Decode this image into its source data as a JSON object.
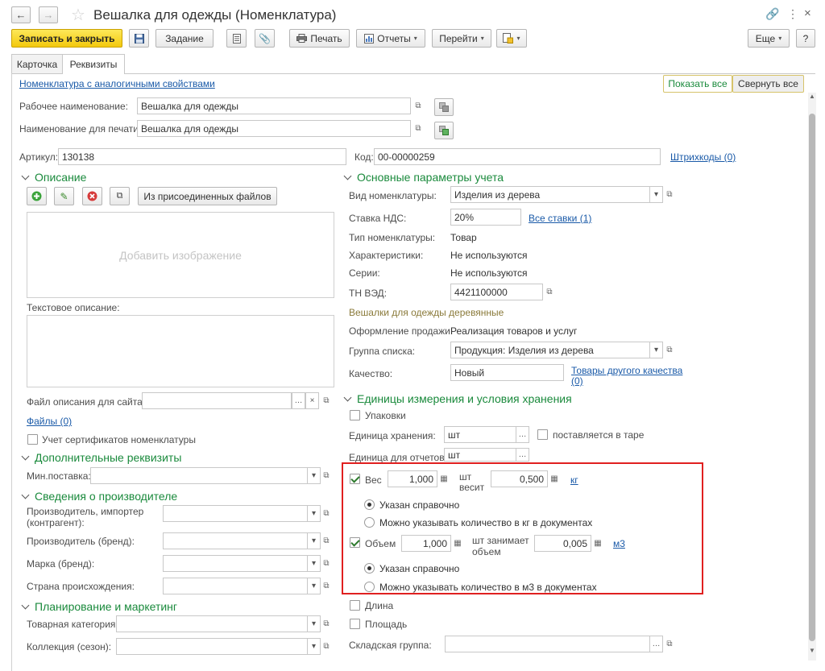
{
  "window": {
    "title": "Вешалка для одежды (Номенклатура)"
  },
  "toolbar": {
    "save_close": "Записать и закрыть",
    "task": "Задание",
    "print": "Печать",
    "reports": "Отчеты",
    "goto": "Перейти",
    "more": "Еще",
    "help": "?"
  },
  "tabs": [
    {
      "label": "Карточка"
    },
    {
      "label": "Реквизиты"
    }
  ],
  "top": {
    "similar_link": "Номенклатура с аналогичными свойствами",
    "show_all": "Показать все",
    "collapse_all": "Свернуть все"
  },
  "names": {
    "work_label": "Рабочее наименование:",
    "work_value": "Вешалка для одежды",
    "print_label": "Наименование для печати:",
    "print_value": "Вешалка для одежды"
  },
  "codes": {
    "article_label": "Артикул:",
    "article_value": "130138",
    "code_label": "Код:",
    "code_value": "00-00000259",
    "barcodes_link": "Штрихкоды (0)"
  },
  "description": {
    "header": "Описание",
    "attached_files_btn": "Из присоединенных файлов",
    "add_image": "Добавить изображение",
    "text_label": "Текстовое описание:",
    "site_file_label": "Файл описания для сайта:",
    "files_link": "Файлы (0)",
    "certificates_label": "Учет сертификатов номенклатуры"
  },
  "additional": {
    "header": "Дополнительные реквизиты",
    "min_supply_label": "Мин.поставка:"
  },
  "manufacturer": {
    "header": "Сведения о производителе",
    "importer_label_1": "Производитель, импортер",
    "importer_label_2": "(контрагент):",
    "brand_label": "Производитель (бренд):",
    "mark_label": "Марка (бренд):",
    "country_label": "Страна происхождения:"
  },
  "planning": {
    "header": "Планирование и маркетинг",
    "category_label": "Товарная категория:",
    "collection_label": "Коллекция (сезон):"
  },
  "accounting": {
    "header": "Основные параметры учета",
    "kind_label": "Вид номенклатуры:",
    "kind_value": "Изделия из дерева",
    "vat_label": "Ставка НДС:",
    "vat_value": "20%",
    "all_rates_link": "Все ставки (1)",
    "type_label": "Тип номенклатуры:",
    "type_value": "Товар",
    "chars_label": "Характеристики:",
    "chars_value": "Не используются",
    "series_label": "Серии:",
    "series_value": "Не используются",
    "tnved_label": "ТН ВЭД:",
    "tnved_value": "4421100000",
    "tnved_desc": "Вешалки для одежды деревянные",
    "sale_label": "Оформление продажи:",
    "sale_value": "Реализация товаров и услуг",
    "group_label": "Группа списка:",
    "group_value": "Продукция: Изделия из дерева",
    "quality_label": "Качество:",
    "quality_value": "Новый",
    "other_quality_link_1": "Товары другого качества",
    "other_quality_link_2": "(0)"
  },
  "units": {
    "header": "Единицы измерения и условия хранения",
    "packages_label": "Упаковки",
    "storage_label": "Единица хранения:",
    "storage_value": "шт",
    "tare_label": "поставляется в таре",
    "report_label": "Единица для отчетов:",
    "report_value": "шт",
    "weight_label": "Вес",
    "weight_qty": "1,000",
    "weight_unit_1": "шт",
    "weight_unit_2": "весит",
    "weight_value": "0,500",
    "weight_uom": "кг",
    "weight_opt1": "Указан справочно",
    "weight_opt2": "Можно указывать количество в кг в документах",
    "volume_label": "Объем",
    "volume_qty": "1,000",
    "volume_unit_1": "шт занимает",
    "volume_unit_2": "объем",
    "volume_value": "0,005",
    "volume_uom": "м3",
    "volume_opt1": "Указан справочно",
    "volume_opt2": "Можно указывать количество в м3 в документах",
    "length_label": "Длина",
    "area_label": "Площадь",
    "warehouse_label": "Складская группа:"
  },
  "colors": {
    "accent_green": "#1a8a3c",
    "link_blue": "#1a5aa8",
    "primary_yellow": "#f5cf1c",
    "highlight_red": "#e02020"
  }
}
